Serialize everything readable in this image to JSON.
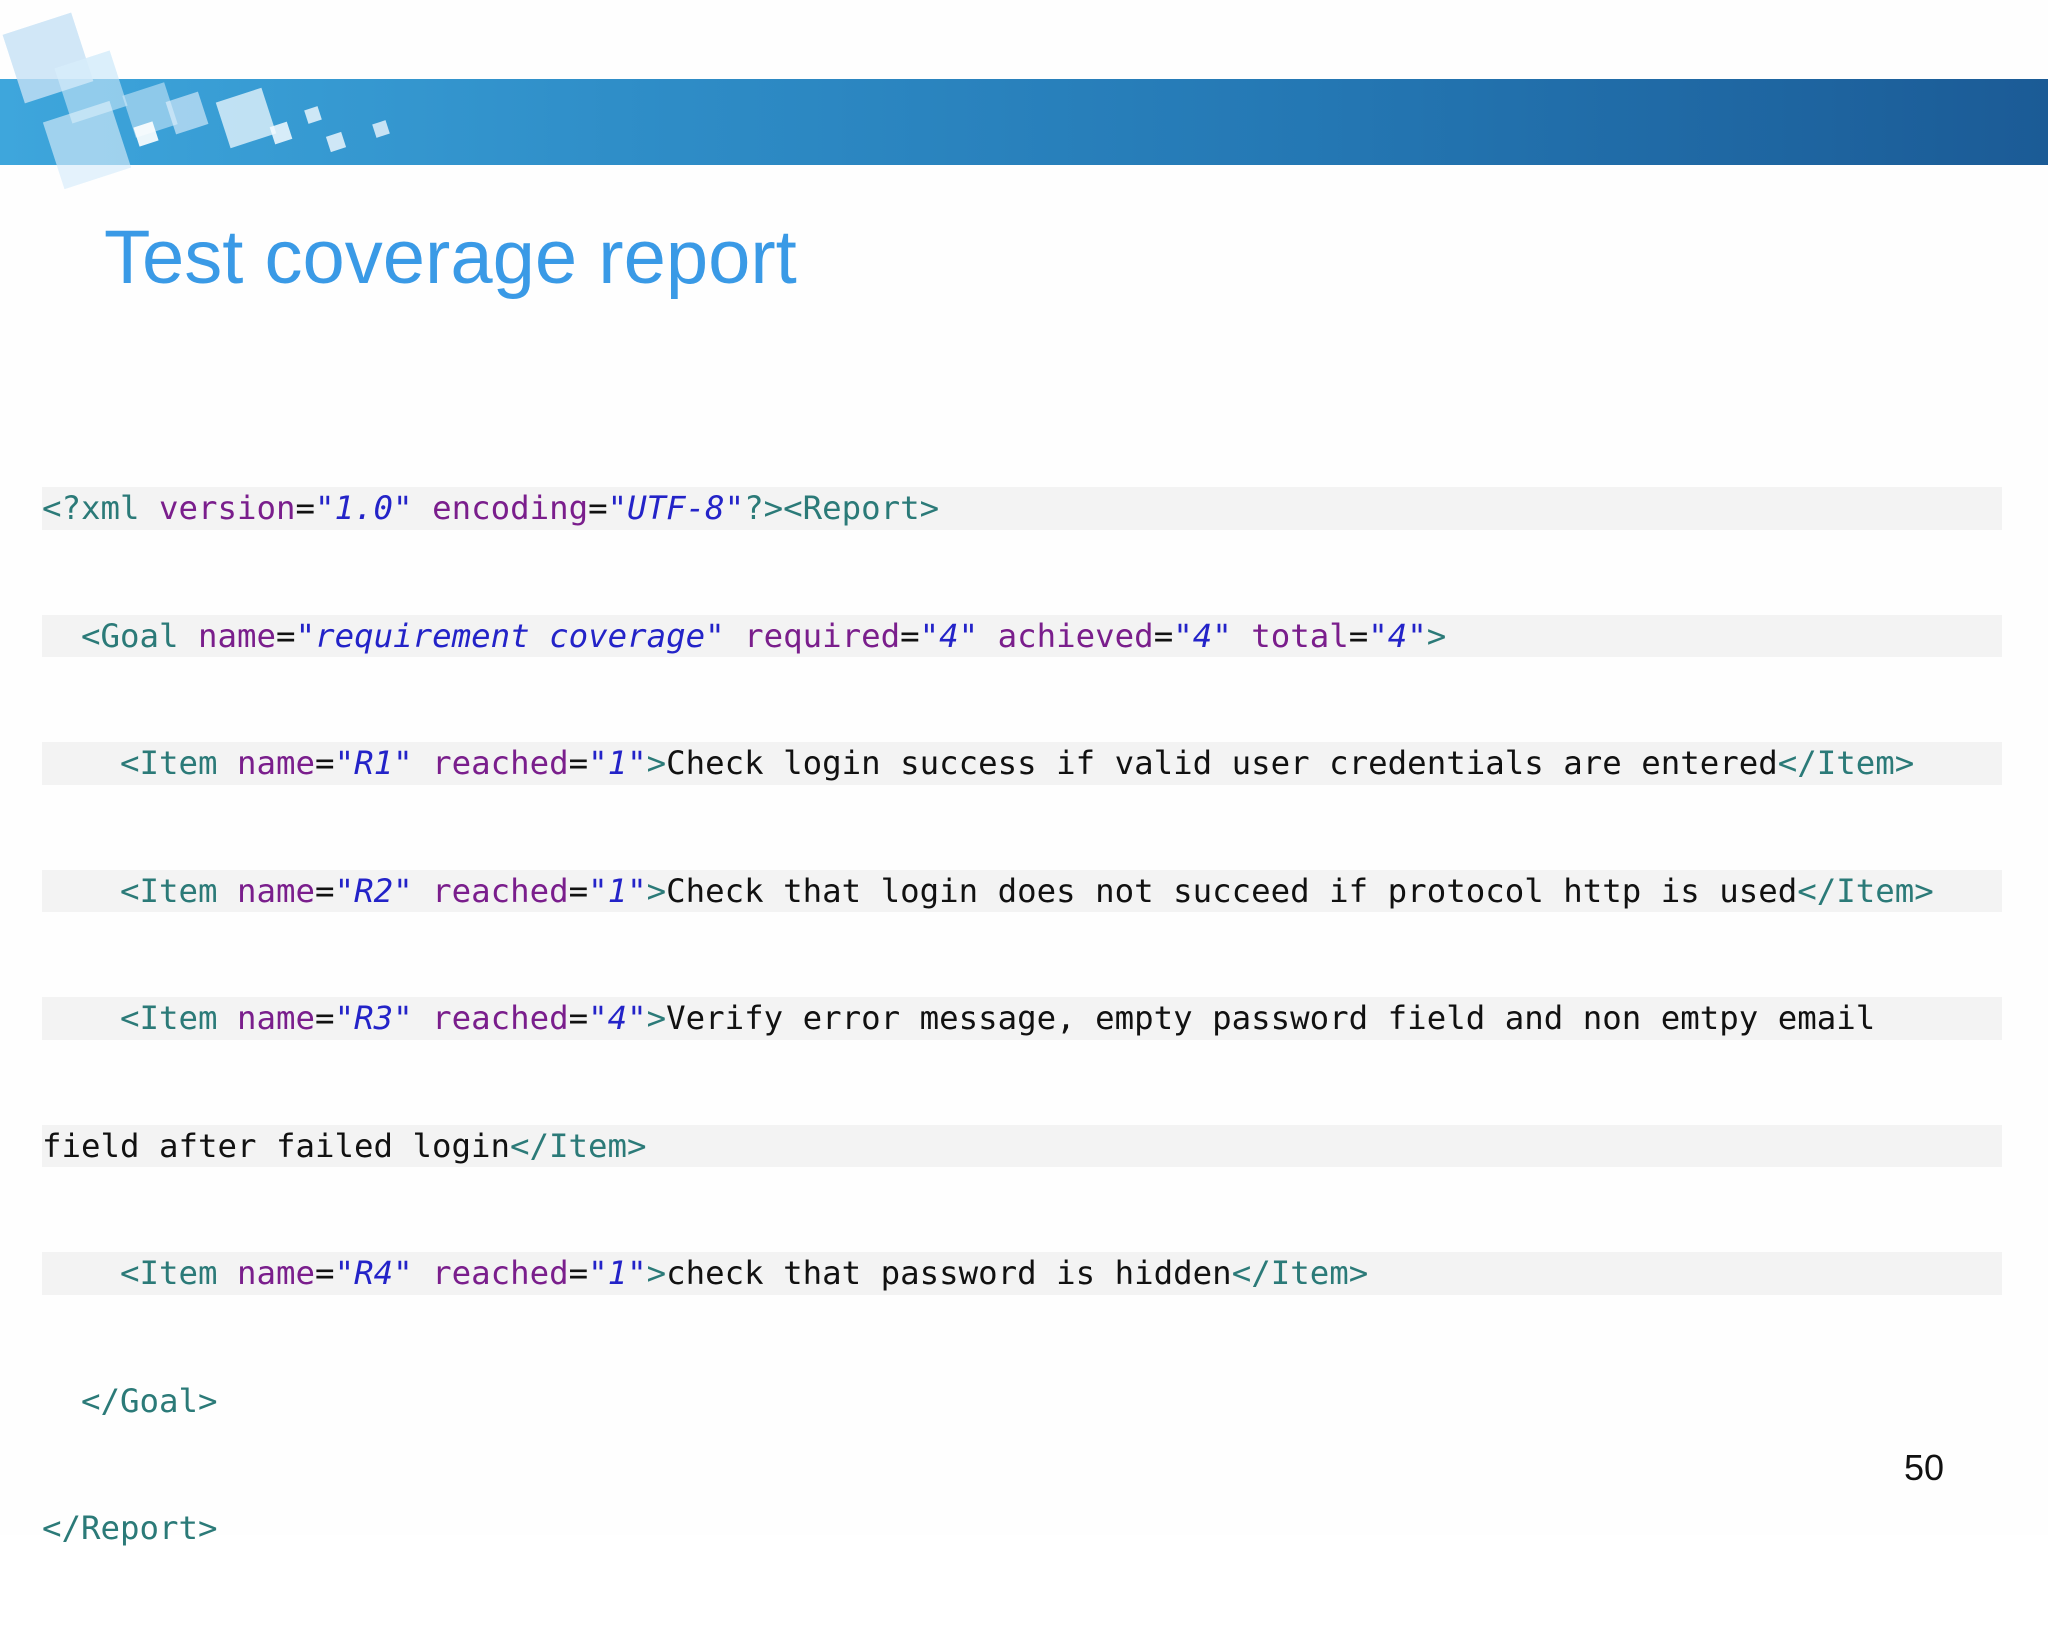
{
  "slide": {
    "title": "Test coverage report",
    "page_number": "50"
  },
  "colors": {
    "title": "#3a9ae6",
    "band_start": "#3ea6dc",
    "band_end": "#1b5b96",
    "xml_tag": "#2b7a78",
    "xml_attr": "#7a1e8c",
    "xml_value": "#2323c8"
  },
  "code": {
    "l1": {
      "pi_open": "<?xml ",
      "attr_version": "version",
      "val_version": "\"1.0\"",
      "attr_encoding": "encoding",
      "val_encoding": "\"UTF-8\"",
      "pi_close": "?>",
      "report_open": "<Report>"
    },
    "l2": {
      "indent": "  ",
      "goal_open": "<Goal ",
      "attr_name": "name",
      "val_name": "\"requirement coverage\"",
      "attr_required": "required",
      "val_required": "\"4\"",
      "attr_achieved": "achieved",
      "val_achieved": "\"4\"",
      "attr_total": "total",
      "val_total": "\"4\"",
      "goal_close": ">"
    },
    "items": [
      {
        "indent": "    ",
        "open": "<Item ",
        "attr_name": "name",
        "val_name": "\"R1\"",
        "attr_reached": "reached",
        "val_reached": "\"1\"",
        "gt": ">",
        "text": "Check login success if valid user credentials are entered",
        "close": "</Item>"
      },
      {
        "indent": "    ",
        "open": "<Item ",
        "attr_name": "name",
        "val_name": "\"R2\"",
        "attr_reached": "reached",
        "val_reached": "\"1\"",
        "gt": ">",
        "text": "Check that login does not succeed if protocol http is used",
        "close": "</Item>"
      },
      {
        "indent": "    ",
        "open": "<Item ",
        "attr_name": "name",
        "val_name": "\"R3\"",
        "attr_reached": "reached",
        "val_reached": "\"4\"",
        "gt": ">",
        "text": "Verify error message, empty password field and non emtpy email",
        "text_wrap": "field after failed login",
        "close": "</Item>"
      },
      {
        "indent": "    ",
        "open": "<Item ",
        "attr_name": "name",
        "val_name": "\"R4\"",
        "attr_reached": "reached",
        "val_reached": "\"1\"",
        "gt": ">",
        "text": "check that password is hidden",
        "close": "</Item>"
      }
    ],
    "goal_end": "</Goal>",
    "report_end": "</Report>"
  }
}
